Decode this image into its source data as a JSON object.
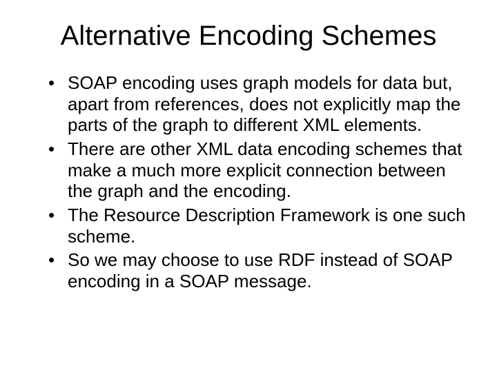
{
  "title": "Alternative Encoding Schemes",
  "bullets": [
    "SOAP encoding uses graph models for data but, apart from references, does not explicitly map the parts of the graph to different XML elements.",
    "There are other XML data encoding schemes that make a much more explicit connection between the graph and the encoding.",
    "The Resource Description Framework is one such scheme.",
    "So we may choose to use RDF instead of SOAP encoding in a SOAP message."
  ]
}
